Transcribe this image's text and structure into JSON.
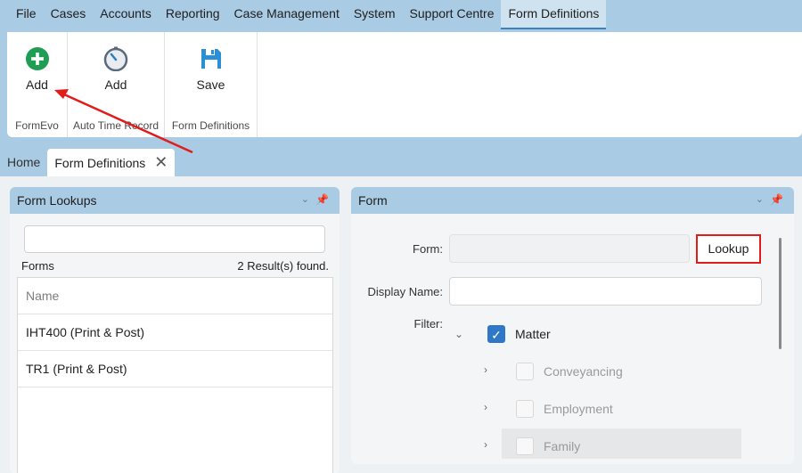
{
  "menubar": {
    "items": [
      "File",
      "Cases",
      "Accounts",
      "Reporting",
      "Case Management",
      "System",
      "Support Centre",
      "Form Definitions"
    ],
    "active_index": 7
  },
  "ribbon": {
    "groups": [
      {
        "label": "FormEvo",
        "button_label": "Add",
        "icon": "plus-circle-icon"
      },
      {
        "label": "Auto Time Record",
        "button_label": "Add",
        "icon": "stopwatch-icon"
      },
      {
        "label": "Form Definitions",
        "button_label": "Save",
        "icon": "floppy-disk-icon"
      }
    ]
  },
  "tabs": {
    "home": "Home",
    "active": "Form Definitions",
    "close_glyph": "✕"
  },
  "left_panel": {
    "title": "Form Lookups",
    "search_value": "",
    "forms_label": "Forms",
    "results_text": "2 Result(s) found.",
    "grid": {
      "header": "Name",
      "rows": [
        "IHT400 (Print & Post)",
        "TR1 (Print & Post)"
      ]
    }
  },
  "right_panel": {
    "title": "Form",
    "form_label": "Form:",
    "form_value": "",
    "lookup_button": "Lookup",
    "display_name_label": "Display Name:",
    "display_name_value": "",
    "filter_label": "Filter:",
    "tree": [
      {
        "label": "Matter",
        "checked": true,
        "expanded": true
      },
      {
        "label": "Conveyancing",
        "checked": false
      },
      {
        "label": "Employment",
        "checked": false
      },
      {
        "label": "Family",
        "checked": false
      }
    ]
  },
  "colors": {
    "accent_blue": "#a9cbe3",
    "checkbox_blue": "#2f78c8",
    "annotation_red": "#e21b1b",
    "add_green": "#1f9d55"
  }
}
